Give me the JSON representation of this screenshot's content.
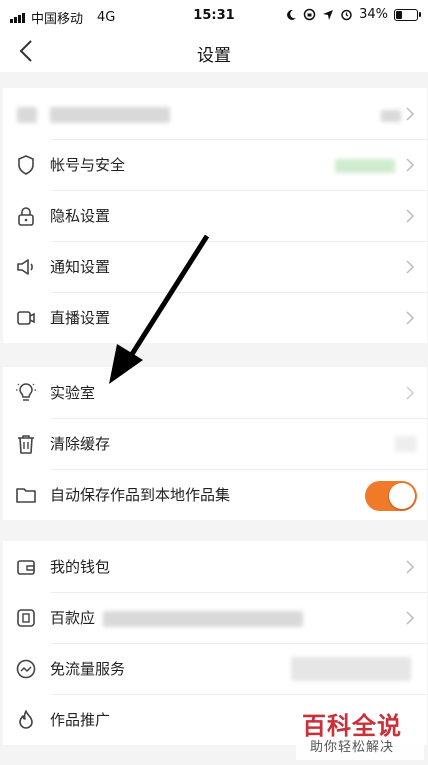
{
  "status_bar": {
    "carrier": "中国移动",
    "network": "4G",
    "time": "15:31",
    "battery_percent": "34%",
    "battery_level": 0.34
  },
  "nav": {
    "title": "设置"
  },
  "groups": [
    {
      "items": [
        {
          "label": ""
        },
        {
          "label": "帐号与安全",
          "icon": "shield-icon"
        },
        {
          "label": "隐私设置",
          "icon": "lock-icon"
        },
        {
          "label": "通知设置",
          "icon": "speaker-icon"
        },
        {
          "label": "直播设置",
          "icon": "camera-icon"
        }
      ]
    },
    {
      "items": [
        {
          "label": "实验室",
          "icon": "lightbulb-icon"
        },
        {
          "label": "清除缓存",
          "icon": "trash-icon"
        },
        {
          "label": "自动保存作品到本地作品集",
          "icon": "folder-icon",
          "toggle_on": true
        }
      ]
    },
    {
      "items": [
        {
          "label": "我的钱包",
          "icon": "wallet-icon"
        },
        {
          "label": "百款应",
          "icon": "app-icon"
        },
        {
          "label": "免流量服务",
          "icon": "trend-icon"
        },
        {
          "label": "作品推广",
          "icon": "fire-icon"
        }
      ]
    }
  ],
  "watermark": {
    "title": "百科全说",
    "subtitle": "助你轻松解决"
  },
  "colors": {
    "accent": "#f07a2a",
    "watermark": "#c9303a"
  }
}
